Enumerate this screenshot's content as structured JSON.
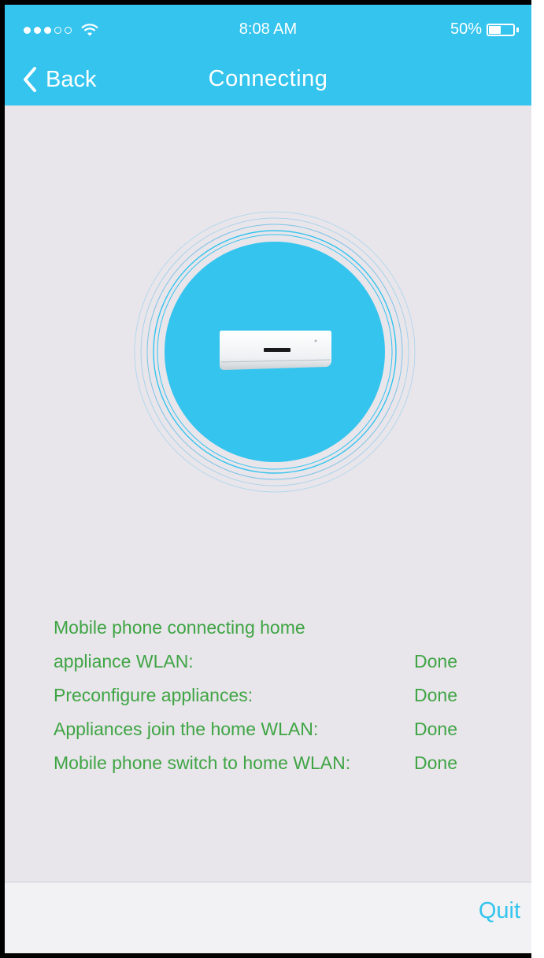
{
  "status_bar": {
    "time": "8:08 AM",
    "battery_percent": "50%",
    "battery_level": 0.5,
    "signal_bars_filled": 3,
    "signal_bars_total": 5
  },
  "nav": {
    "back_label": "Back",
    "title": "Connecting"
  },
  "steps": [
    {
      "label": "Mobile phone connecting home",
      "value": ""
    },
    {
      "label": "appliance WLAN:",
      "value": "Done"
    },
    {
      "label": "Preconfigure appliances:",
      "value": "Done"
    },
    {
      "label": "Appliances join the home WLAN:",
      "value": "Done"
    },
    {
      "label": "Mobile phone switch to home WLAN:",
      "value": "Done"
    }
  ],
  "footer": {
    "quit_label": "Quit"
  },
  "colors": {
    "accent": "#35c4ee",
    "status_text": "#3fa544",
    "background": "#e8e5eb"
  },
  "icons": {
    "back": "chevron-left-icon",
    "wifi": "wifi-icon",
    "battery": "battery-icon",
    "appliance": "air-conditioner-icon"
  }
}
